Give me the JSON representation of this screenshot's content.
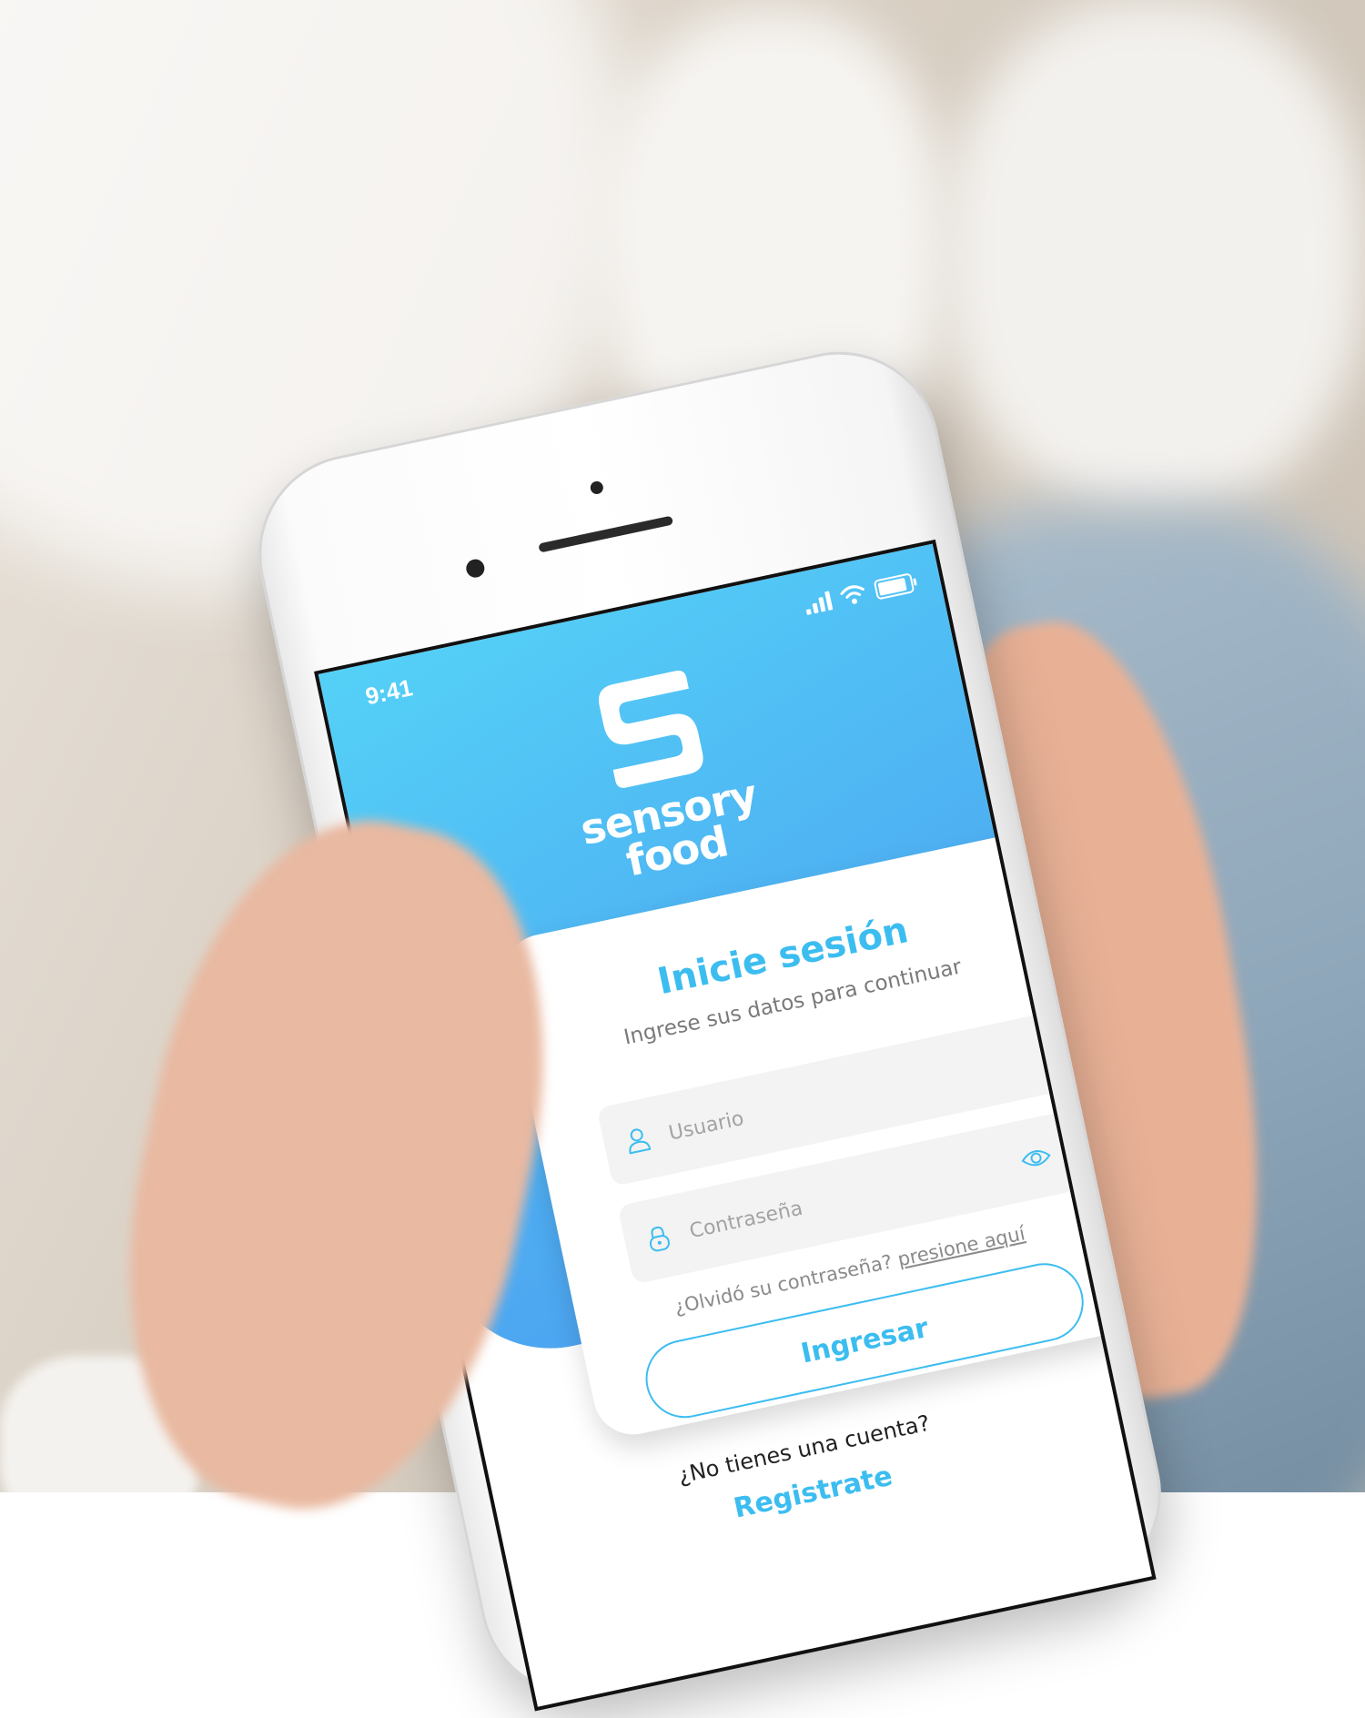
{
  "status_bar": {
    "time": "9:41"
  },
  "brand": {
    "name_line1": "sensory",
    "name_line2": "food"
  },
  "login": {
    "title": "Inicie sesión",
    "subtitle": "Ingrese sus datos para continuar",
    "username_placeholder": "Usuario",
    "password_placeholder": "Contraseña",
    "forgot_text": "¿Olvidó su contraseña?",
    "forgot_link": "presione aquí",
    "submit_label": "Ingresar"
  },
  "signup": {
    "prompt": "¿No tienes una cuenta?",
    "link_label": "Registrate"
  },
  "colors": {
    "accent": "#3cbdf0",
    "hero_gradient_start": "#54d1f7",
    "hero_gradient_end": "#4c9bef"
  },
  "icons": {
    "username": "user-icon",
    "password": "lock-icon",
    "visibility": "eye-icon",
    "signal": "signal-icon",
    "wifi": "wifi-icon",
    "battery": "battery-icon"
  }
}
